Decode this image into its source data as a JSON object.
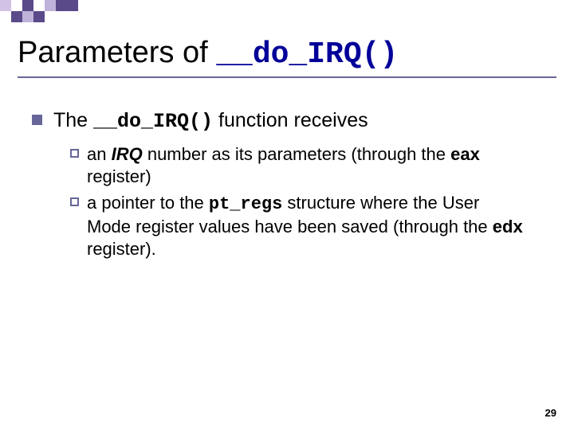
{
  "decoration": {
    "row1": [
      "#d1c2e6",
      "#ffffff",
      "#5a4a8a",
      "#ffffff",
      "#bfb3d9",
      "#5a4a8a",
      "#5a4a8a"
    ],
    "row2": [
      "#ffffff",
      "#5a4a8a",
      "#bfb3d9",
      "#5a4a8a"
    ]
  },
  "title": {
    "prefix": "Parameters of ",
    "code": "__do_IRQ()"
  },
  "main_point": {
    "pre": "The ",
    "code": "__do_IRQ()",
    "post": " function receives"
  },
  "sub_points": [
    {
      "parts": [
        {
          "t": "an ",
          "cls": ""
        },
        {
          "t": "IRQ",
          "cls": "bold-italic"
        },
        {
          "t": " number as its parameters (through the ",
          "cls": ""
        },
        {
          "t": "eax",
          "cls": "bold"
        },
        {
          "t": " register)",
          "cls": ""
        }
      ]
    },
    {
      "parts": [
        {
          "t": "a pointer to the ",
          "cls": ""
        },
        {
          "t": "pt_regs",
          "cls": "code-inline"
        },
        {
          "t": " structure where the User Mode register values have been saved (through the ",
          "cls": ""
        },
        {
          "t": "edx",
          "cls": "bold"
        },
        {
          "t": " register).",
          "cls": ""
        }
      ]
    }
  ],
  "page_number": "29"
}
